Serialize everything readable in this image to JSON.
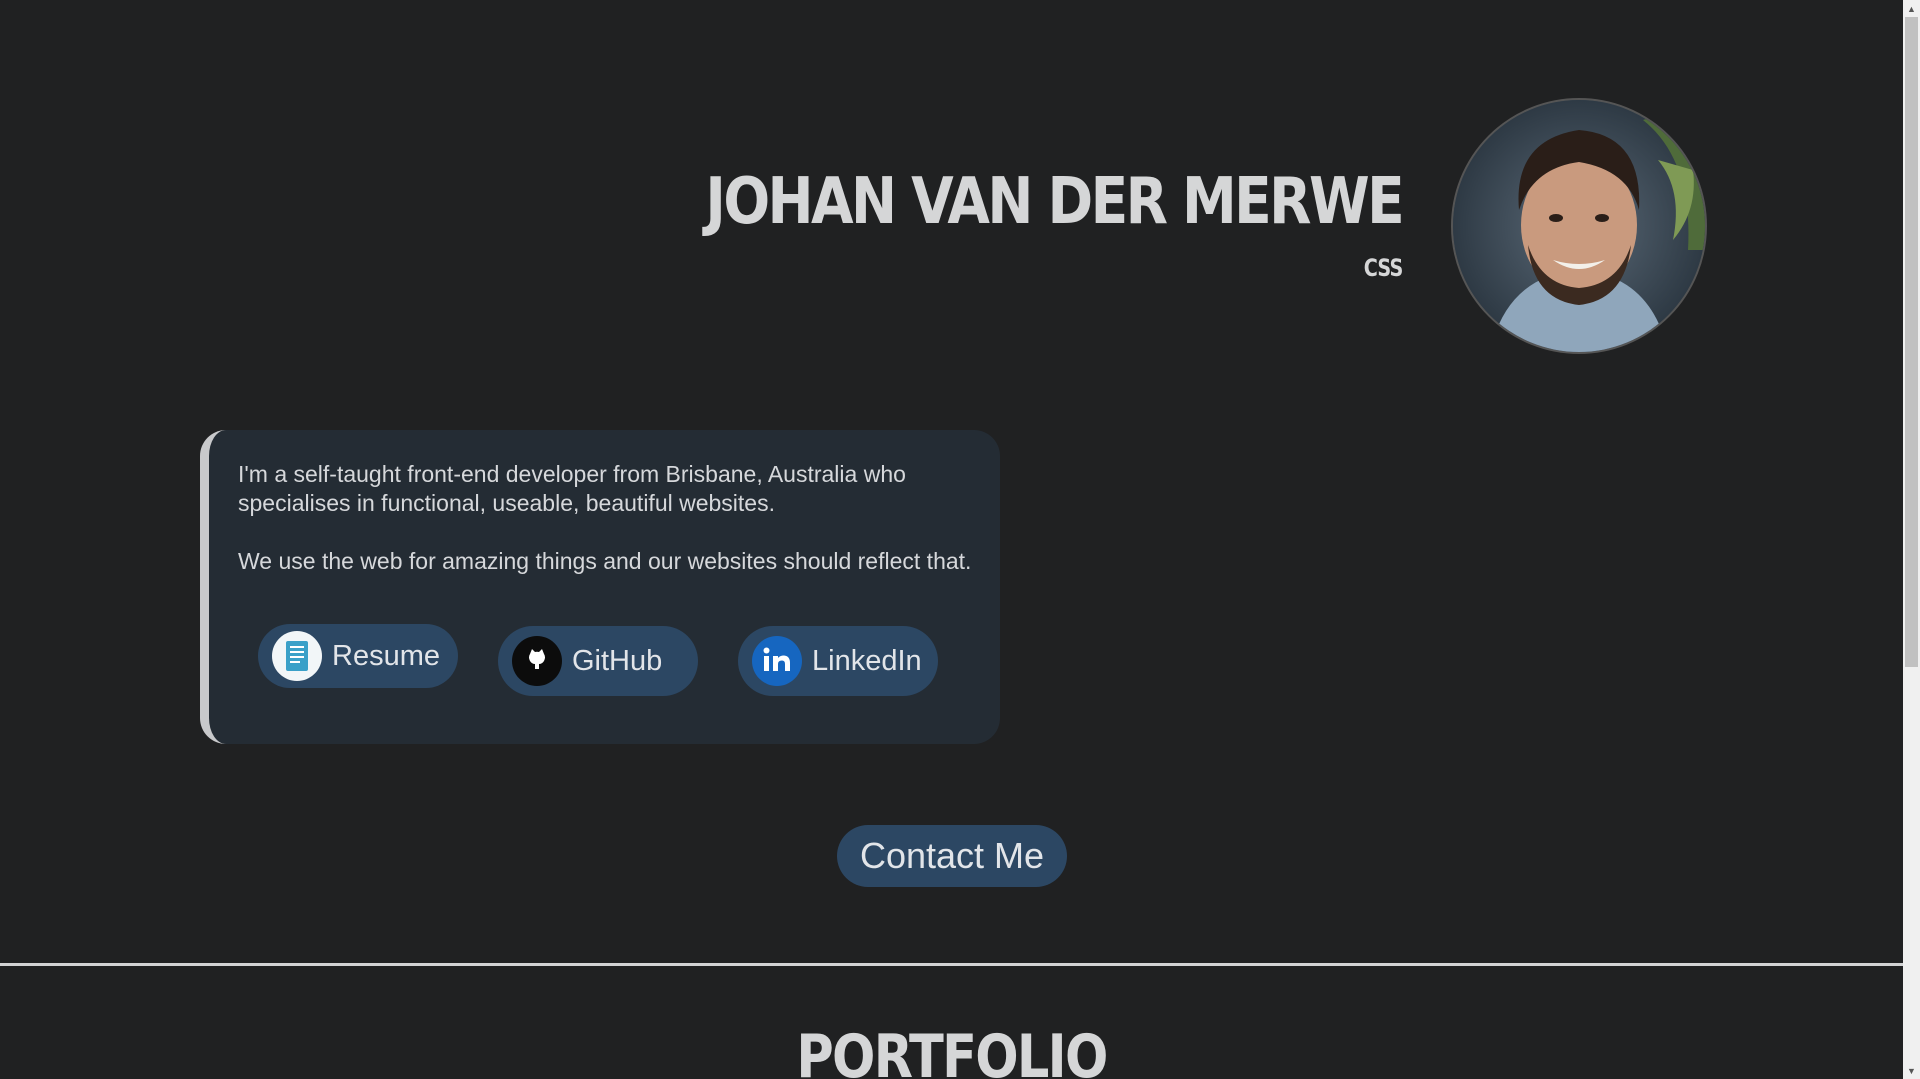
{
  "header": {
    "name": "Johan van der Merwe",
    "subtitle": "CSS",
    "avatar_alt": "profile-photo"
  },
  "about": {
    "paragraph1": "I'm a self-taught front-end developer from Brisbane, Australia who specialises in functional, useable, beautiful websites.",
    "paragraph2": "We use the web for amazing things and our websites should reflect that."
  },
  "links": {
    "resume": "Resume",
    "github": "GitHub",
    "linkedin": "LinkedIn"
  },
  "contact_label": "Contact Me",
  "portfolio_heading": "Portfolio",
  "colors": {
    "background": "#202122",
    "card": "#242c34",
    "button": "#2c4763",
    "text": "#d5d6d7"
  },
  "icons": {
    "resume": "document-icon",
    "github": "github-icon",
    "linkedin": "linkedin-icon"
  }
}
